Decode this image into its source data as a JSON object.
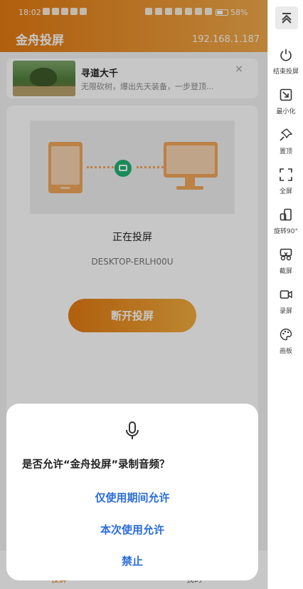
{
  "status_bar": {
    "time": "18:02",
    "battery_percent": "58%",
    "battery_level": 0.58
  },
  "header": {
    "title": "金舟投屏",
    "ip": "192.168.1.187"
  },
  "ad": {
    "title": "寻道大千",
    "description": "无限砍树，爆出先天装备，一步登顶..."
  },
  "cast_card": {
    "status": "正在投屏",
    "device": "DESKTOP-ERLH00U",
    "disconnect_label": "断开投屏"
  },
  "bottom_nav": {
    "items": [
      {
        "label": "投屏"
      },
      {
        "label": "我的"
      }
    ]
  },
  "dialog": {
    "question": "是否允许“金舟投屏”录制音频？",
    "options": [
      {
        "label": "仅使用期间允许"
      },
      {
        "label": "本次使用允许"
      },
      {
        "label": "禁止"
      }
    ]
  },
  "toolbar": {
    "items": [
      {
        "label": "结束投屏",
        "icon": "power-icon"
      },
      {
        "label": "最小化",
        "icon": "minimize-icon"
      },
      {
        "label": "置顶",
        "icon": "pin-icon"
      },
      {
        "label": "全屏",
        "icon": "fullscreen-icon"
      },
      {
        "label": "旋转90°",
        "icon": "rotate-icon"
      },
      {
        "label": "截屏",
        "icon": "scissors-icon"
      },
      {
        "label": "录屏",
        "icon": "video-icon"
      },
      {
        "label": "画板",
        "icon": "palette-icon"
      }
    ]
  },
  "colors": {
    "accent": "#e27a12",
    "link": "#2a6dd9",
    "connected": "#21b373"
  }
}
